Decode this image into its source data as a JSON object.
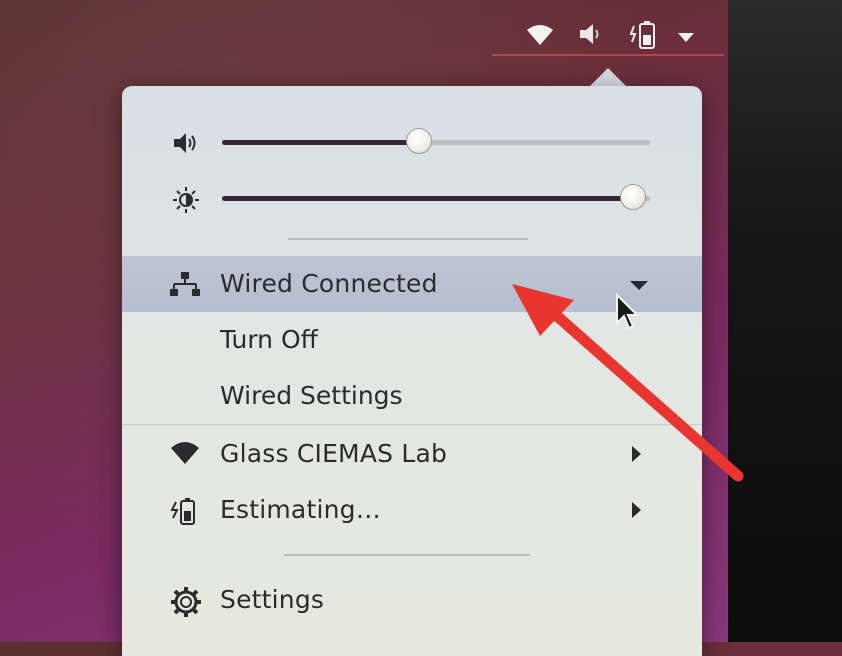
{
  "topbar": {
    "icons": [
      "wifi-icon",
      "volume-icon",
      "battery-icon",
      "menu-caret-icon"
    ]
  },
  "sliders": {
    "volume": {
      "icon": "volume-icon",
      "level": 0.46
    },
    "brightness": {
      "icon": "brightness-icon",
      "level": 0.96
    }
  },
  "network": {
    "label": "Wired Connected",
    "icon": "wired-network-icon",
    "expanded": true,
    "submenu": [
      {
        "label": "Turn Off"
      },
      {
        "label": "Wired Settings"
      }
    ]
  },
  "wifi": {
    "label": "Glass CIEMAS Lab",
    "icon": "wifi-icon"
  },
  "battery": {
    "label": "Estimating…",
    "icon": "battery-icon"
  },
  "settings": {
    "label": "Settings",
    "icon": "gear-icon"
  },
  "colors": {
    "accent_highlight": "#b8c1d0",
    "annotation_arrow": "#e8352f",
    "slider_fill": "#3a2433"
  }
}
